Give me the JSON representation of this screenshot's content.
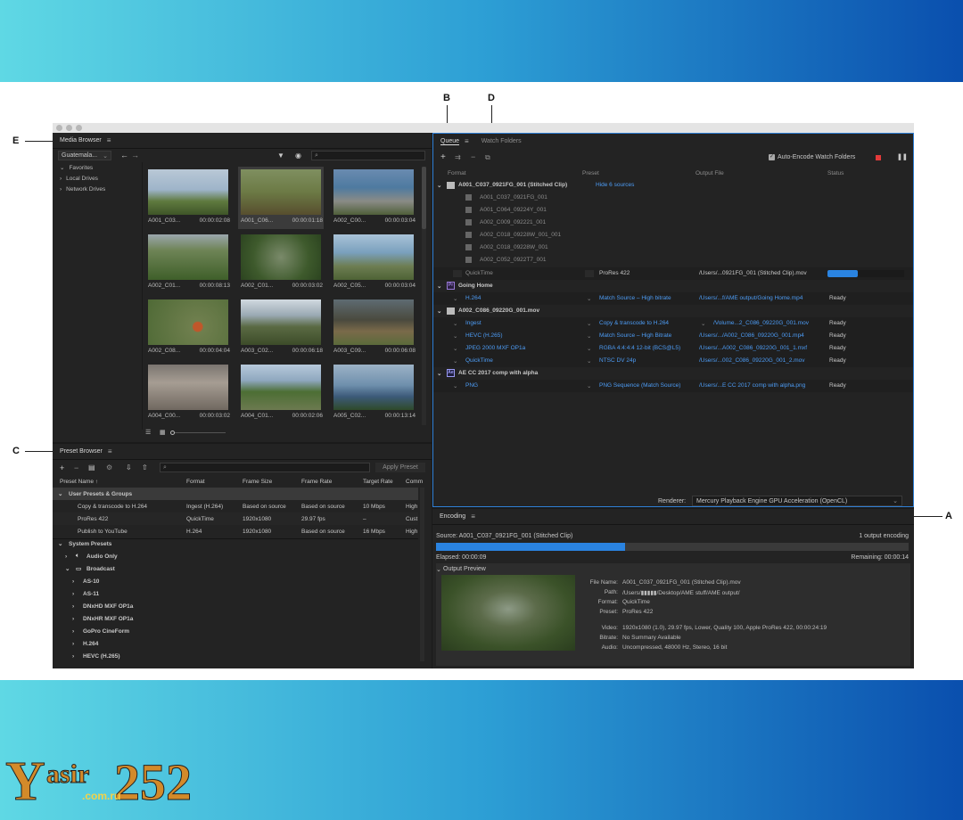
{
  "callouts": {
    "a": "A",
    "b": "B",
    "c": "C",
    "d": "D",
    "e": "E"
  },
  "media_browser": {
    "title": "Media Browser",
    "location": "Guatemala...",
    "tree": [
      "Favorites",
      "Local Drives",
      "Network Drives"
    ],
    "clips": [
      {
        "name": "A001_C03...",
        "duration": "00:00:02:08"
      },
      {
        "name": "A001_C06...",
        "duration": "00:00:01:18"
      },
      {
        "name": "A002_C00...",
        "duration": "00:00:03:04"
      },
      {
        "name": "A002_C01...",
        "duration": "00:00:08:13"
      },
      {
        "name": "A002_C01...",
        "duration": "00:00:03:02"
      },
      {
        "name": "A002_C05...",
        "duration": "00:00:03:04"
      },
      {
        "name": "A002_C08...",
        "duration": "00:00:04:04"
      },
      {
        "name": "A003_C02...",
        "duration": "00:00:06:18"
      },
      {
        "name": "A003_C09...",
        "duration": "00:00:06:08"
      },
      {
        "name": "A004_C00...",
        "duration": "00:00:03:02"
      },
      {
        "name": "A004_C01...",
        "duration": "00:00:02:06"
      },
      {
        "name": "A005_C02...",
        "duration": "00:00:13:14"
      }
    ]
  },
  "preset_browser": {
    "title": "Preset Browser",
    "apply": "Apply Preset",
    "columns": [
      "Preset Name ↑",
      "Format",
      "Frame Size",
      "Frame Rate",
      "Target Rate",
      "Comm"
    ],
    "user_group": "User Presets & Groups",
    "user_presets": [
      {
        "name": "Copy & transcode to H.264",
        "format": "Ingest (H.264)",
        "size": "Based on source",
        "rate": "Based on source",
        "target": "10 Mbps",
        "comment": "High"
      },
      {
        "name": "ProRes 422",
        "format": "QuickTime",
        "size": "1920x1080",
        "rate": "29.97 fps",
        "target": "–",
        "comment": "Cust"
      },
      {
        "name": "Publish to YouTube",
        "format": "H.264",
        "size": "1920x1080",
        "rate": "Based on source",
        "target": "16 Mbps",
        "comment": "High"
      }
    ],
    "system_group": "System Presets",
    "system_items": [
      "Audio Only",
      "Broadcast",
      "AS-10",
      "AS-11",
      "DNxHD MXF OP1a",
      "DNxHR MXF OP1a",
      "GoPro CineForm",
      "H.264",
      "HEVC (H.265)"
    ]
  },
  "queue": {
    "tab_queue": "Queue",
    "tab_watch": "Watch Folders",
    "auto_encode": "Auto-Encode Watch Folders",
    "columns": [
      "Format",
      "Preset",
      "Output File",
      "Status"
    ],
    "item1": {
      "name": "A001_C037_0921FG_001 (Stitched Clip)",
      "hide": "Hide 6 sources",
      "sources": [
        "A001_C037_0921FG_001",
        "A001_C064_09224Y_001",
        "A002_C009_092221_001",
        "A002_C018_09228W_001_001",
        "A002_C018_09228W_001",
        "A002_C052_0922T7_001"
      ],
      "format": "QuickTime",
      "preset": "ProRes 422",
      "output": "/Users/...0921FG_001 (Stitched Clip).mov",
      "progress": 0.4
    },
    "item2": {
      "name": "Going Home",
      "format": "H.264",
      "preset": "Match Source – High bitrate",
      "output": "/Users/...f/AME output/Going Home.mp4",
      "status": "Ready"
    },
    "item3": {
      "name": "A002_C086_09220G_001.mov",
      "rows": [
        {
          "format": "Ingest",
          "preset": "Copy & transcode to H.264",
          "output": "/Volume...2_C086_09220G_001.mov",
          "status": "Ready"
        },
        {
          "format": "HEVC (H.265)",
          "preset": "Match Source – High Bitrate",
          "output": "/Users/.../A002_C086_09220G_001.mp4",
          "status": "Ready"
        },
        {
          "format": "JPEG 2000 MXF OP1a",
          "preset": "RGBA 4:4:4:4 12-bit (BCS@L5)",
          "output": "/Users/...A002_C086_09220G_001_1.mxf",
          "status": "Ready"
        },
        {
          "format": "QuickTime",
          "preset": "NTSC DV 24p",
          "output": "/Users/...002_C086_09220G_001_2.mov",
          "status": "Ready"
        }
      ]
    },
    "item4": {
      "name": "AE CC 2017 comp with alpha",
      "format": "PNG",
      "preset": "PNG Sequence (Match Source)",
      "output": "/Users/...E CC 2017 comp with alpha.png",
      "status": "Ready"
    },
    "renderer_label": "Renderer:",
    "renderer_value": "Mercury Playback Engine GPU Acceleration (OpenCL)"
  },
  "encoding": {
    "title": "Encoding",
    "source": "Source: A001_C037_0921FG_001 (Stitched Clip)",
    "outputs": "1 output encoding",
    "progress": 0.4,
    "elapsed": "Elapsed: 00:00:09",
    "remaining": "Remaining: 00:00:14",
    "preview_label": "Output Preview",
    "meta": [
      {
        "k": "File Name:",
        "v": "A001_C037_0921FG_001 (Stitched Clip).mov"
      },
      {
        "k": "Path:",
        "v": "/Users/▮▮▮▮▮/Desktop/AME stuff/AME output/"
      },
      {
        "k": "Format:",
        "v": "QuickTime"
      },
      {
        "k": "Preset:",
        "v": "ProRes 422"
      },
      {
        "k": "Video:",
        "v": "1920x1080 (1.0), 29.97 fps, Lower, Quality 100, Apple ProRes 422, 00:00:24:19"
      },
      {
        "k": "Bitrate:",
        "v": "No Summary Available"
      },
      {
        "k": "Audio:",
        "v": "Uncompressed, 48000 Hz, Stereo, 16 bit"
      }
    ]
  },
  "watermark": {
    "y": "Y",
    "asir": "asir",
    "num": "252",
    "domain": ".com.ru"
  }
}
